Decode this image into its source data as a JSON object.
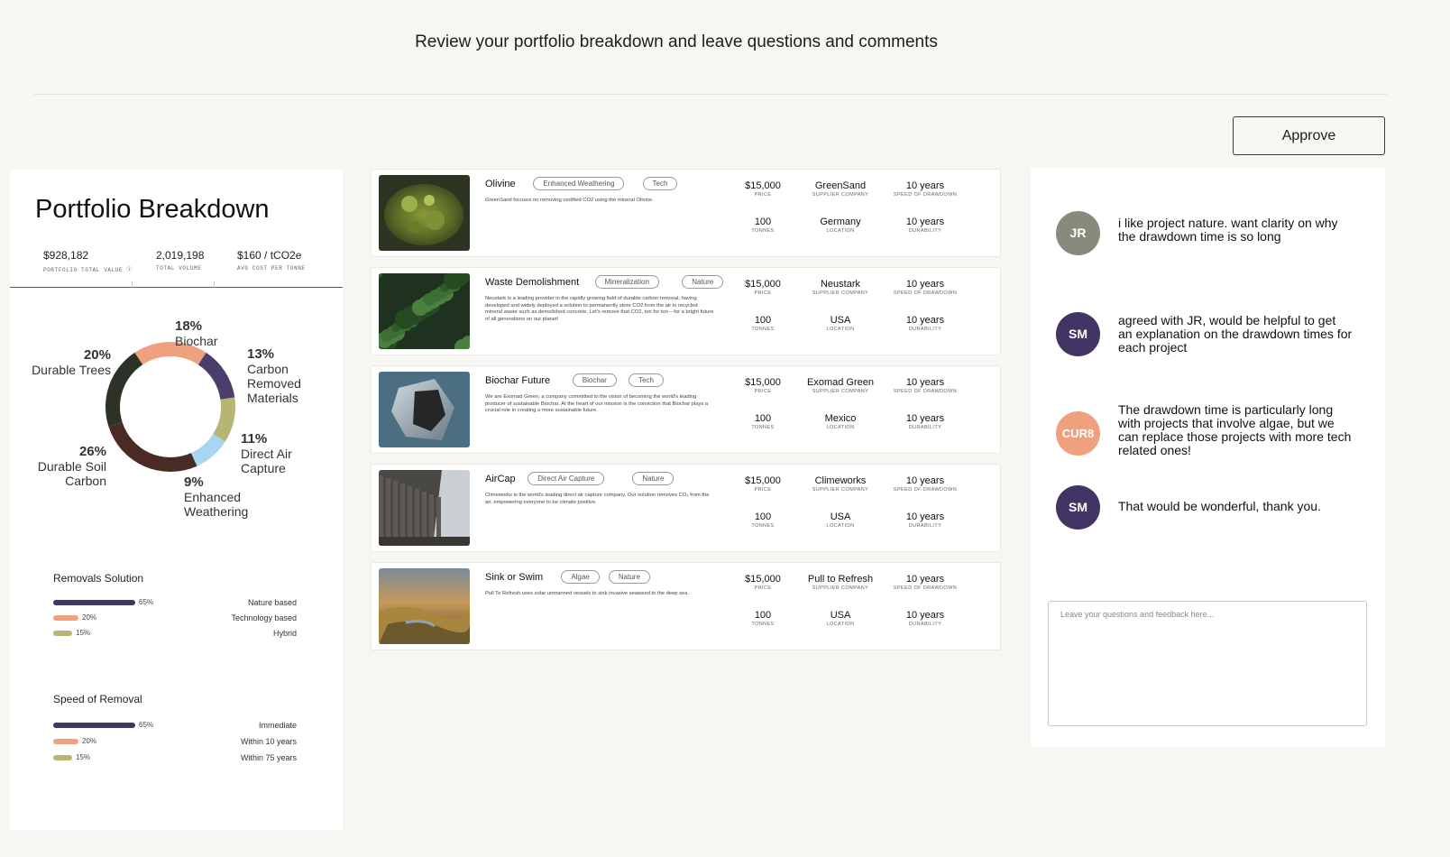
{
  "header": {
    "title": "Review your portfolio breakdown and leave questions and comments"
  },
  "approve_label": "Approve",
  "portfolio": {
    "title": "Portfolio Breakdown",
    "stats": [
      {
        "value": "$928,182",
        "label": "PORTFOLIO TOTAL VALUE"
      },
      {
        "value": "2,019,198",
        "label": "TOTAL VOLUME"
      },
      {
        "value": "$160 / tCO2e",
        "label": "AVG COST PER TONNE"
      }
    ],
    "donut": [
      {
        "pct": "18%",
        "name": "Biochar",
        "value": 18,
        "color": "#eea07f"
      },
      {
        "pct": "13%",
        "name": "Carbon Removed Materials",
        "value": 13,
        "color": "#4b3d6c"
      },
      {
        "pct": "11%",
        "name": "Direct Air Capture",
        "value": 11,
        "color": "#b6b574"
      },
      {
        "pct": "9%",
        "name": "Enhanced Weathering",
        "value": 9,
        "color": "#a7d6f2"
      },
      {
        "pct": "26%",
        "name": "Durable Soil Carbon",
        "value": 26,
        "color": "#4a2b23"
      },
      {
        "pct": "20%",
        "name": "Durable Trees",
        "value": 20,
        "color": "#2d3228"
      }
    ],
    "removals": {
      "title": "Removals Solution",
      "rows": [
        {
          "pct": "65%",
          "value": 65,
          "name": "Nature based",
          "color": "#433466"
        },
        {
          "pct": "20%",
          "value": 20,
          "name": "Technology based",
          "color": "#eea07f"
        },
        {
          "pct": "15%",
          "value": 15,
          "name": "Hybrid",
          "color": "#b6b574"
        }
      ]
    },
    "speed": {
      "title": "Speed of Removal",
      "rows": [
        {
          "pct": "65%",
          "value": 65,
          "name": "Immediate",
          "color": "#433466"
        },
        {
          "pct": "20%",
          "value": 20,
          "name": "Within 10 years",
          "color": "#eea07f"
        },
        {
          "pct": "15%",
          "value": 15,
          "name": "Within 75 years",
          "color": "#b6b574"
        }
      ]
    }
  },
  "projects": [
    {
      "name": "Olivine",
      "tags": [
        "Enhanced Weathering",
        "Tech"
      ],
      "description": "GreenSand focuses on removing certified CO2 using the mineral Olivine.",
      "price": "$15,000",
      "price_label": "PRICE",
      "supplier": "GreenSand",
      "supplier_label": "SUPPLIER COMPANY",
      "speed": "10 years",
      "speed_label": "SPEED OF DRAWDOWN",
      "tonnes": "100",
      "tonnes_label": "TONNES",
      "location": "Germany",
      "location_label": "LOCATION",
      "durability": "10 years",
      "durability_label": "DURABILITY"
    },
    {
      "name": "Waste Demolishment",
      "tags": [
        "Mineralization",
        "Nature"
      ],
      "description": "Neustark is a leading provider in the rapidly growing field of durable carbon removal, having developed and widely deployed a solution to permanently store CO2 from the air in recycled mineral waste such as demolished concrete. Let's remove that CO2, ton for ton – for a bright future of all generations on our planet!",
      "price": "$15,000",
      "price_label": "PRICE",
      "supplier": "Neustark",
      "supplier_label": "SUPPLIER COMPANY",
      "speed": "10 years",
      "speed_label": "SPEED OF DRAWDOWN",
      "tonnes": "100",
      "tonnes_label": "TONNES",
      "location": "USA",
      "location_label": "LOCATION",
      "durability": "10 years",
      "durability_label": "DURABILITY"
    },
    {
      "name": "Biochar Future",
      "tags": [
        "Biochar",
        "Tech"
      ],
      "description": "We are Exomad Green, a company committed to the vision of becoming the world's leading producer of sustainable Biochar. At the heart of our mission is the conviction that Biochar plays a crucial role in creating a more sustainable future.",
      "price": "$15,000",
      "price_label": "PRICE",
      "supplier": "Exomad Green",
      "supplier_label": "SUPPLIER COMPANY",
      "speed": "10 years",
      "speed_label": "SPEED OF DRAWDOWN",
      "tonnes": "100",
      "tonnes_label": "TONNES",
      "location": "Mexico",
      "location_label": "LOCATION",
      "durability": "10 years",
      "durability_label": "DURABILITY"
    },
    {
      "name": "AirCap",
      "tags": [
        "Direct Air Capture",
        "Nature"
      ],
      "description": "Climeworks is the world's leading direct air capture company. Our solution removes CO₂ from the air, empowering everyone to be climate positive.",
      "price": "$15,000",
      "price_label": "PRICE",
      "supplier": "Climeworks",
      "supplier_label": "SUPPLIER COMPANY",
      "speed": "10 years",
      "speed_label": "SPEED OF DRAWDOWN",
      "tonnes": "100",
      "tonnes_label": "TONNES",
      "location": "USA",
      "location_label": "LOCATION",
      "durability": "10 years",
      "durability_label": "DURABILITY"
    },
    {
      "name": "Sink or Swim",
      "tags": [
        "Algae",
        "Nature"
      ],
      "description": "Pull To Refresh uses solar unmanned vessels to sink invasive seaweed to the deep sea.",
      "price": "$15,000",
      "price_label": "PRICE",
      "supplier": "Pull to Refresh",
      "supplier_label": "SUPPLIER COMPANY",
      "speed": "10 years",
      "speed_label": "SPEED OF DRAWDOWN",
      "tonnes": "100",
      "tonnes_label": "TONNES",
      "location": "USA",
      "location_label": "LOCATION",
      "durability": "10 years",
      "durability_label": "DURABILITY"
    }
  ],
  "comments": [
    {
      "initials": "JR",
      "color": "#8a8a7c",
      "text": "i like project nature. want clarity on why the drawdown time is so long"
    },
    {
      "initials": "SM",
      "color": "#433466",
      "text": "agreed with JR, would be helpful to get an explanation on the drawdown times for each project"
    },
    {
      "initials": "CUR8",
      "color": "#eea07f",
      "text": "The drawdown time is particularly long with projects that involve algae, but we can replace those projects with more tech related ones!"
    },
    {
      "initials": "SM",
      "color": "#433466",
      "text": "That would be wonderful, thank you."
    }
  ],
  "feedback": {
    "placeholder": "Leave your questions and feedback here..."
  }
}
